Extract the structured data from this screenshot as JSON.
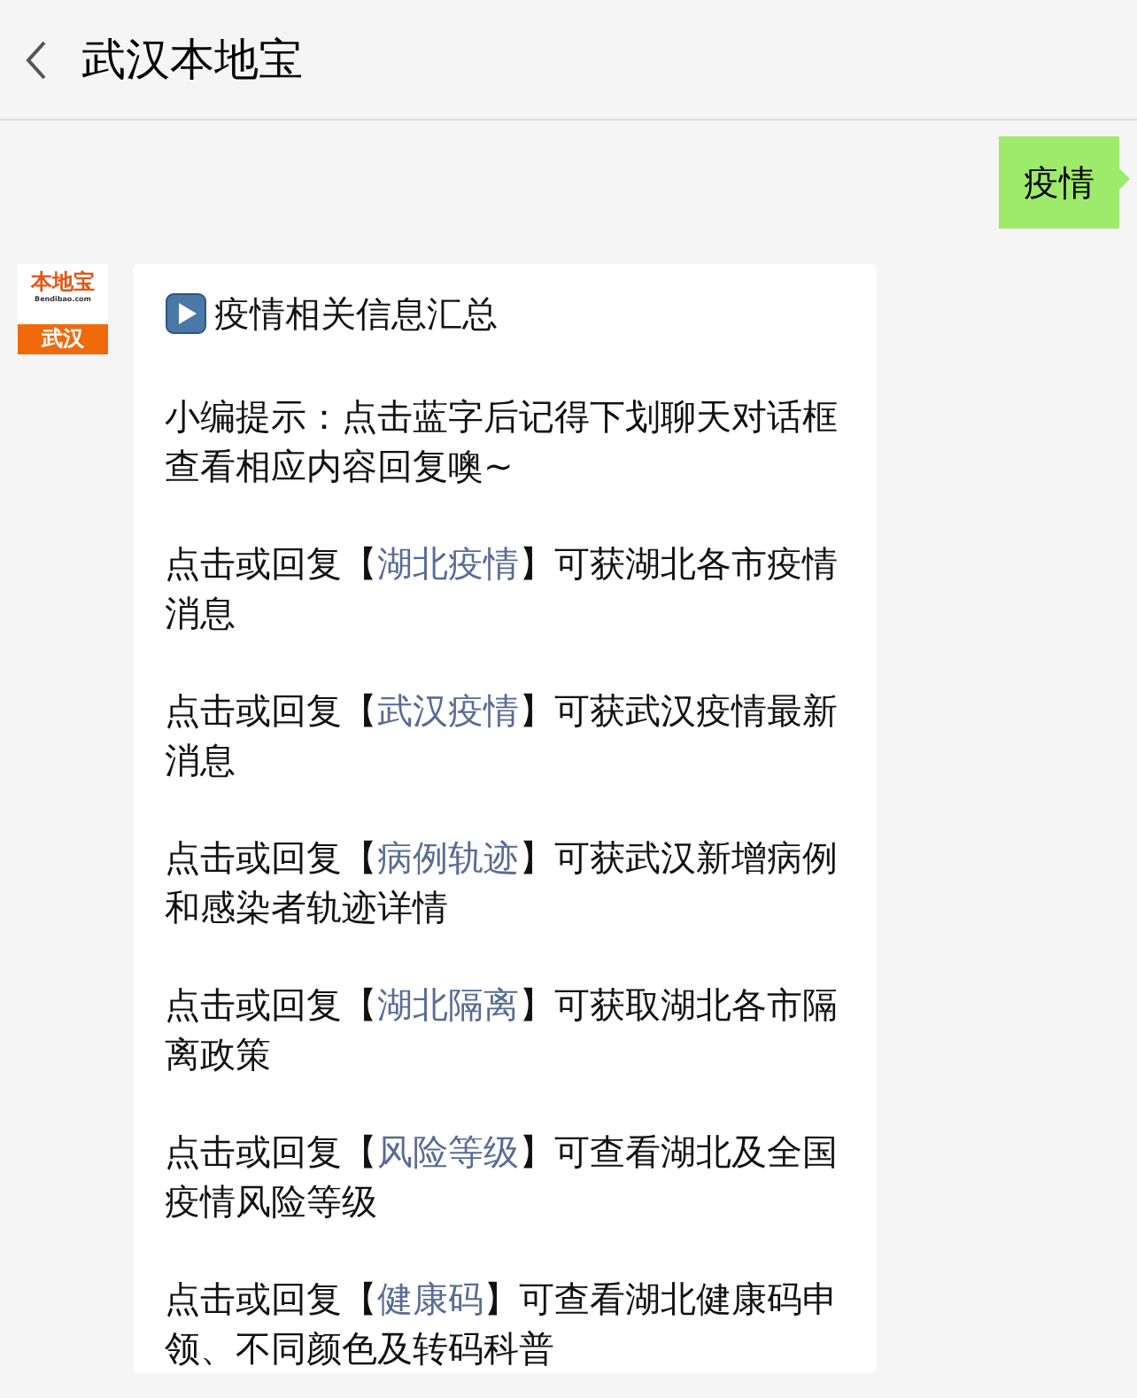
{
  "header": {
    "title": "武汉本地宝"
  },
  "messages": [
    {
      "kind": "outgoing",
      "text": "疫情"
    },
    {
      "kind": "incoming",
      "avatar": {
        "logo": "本地宝",
        "domain": "Bendibao.com",
        "city": "武汉"
      },
      "title": "疫情相关信息汇总",
      "paragraphs": [
        {
          "before": "小编提示：点击蓝字后记得下划聊天对话框查看相应内容回复噢~"
        },
        {
          "before": "点击或回复【",
          "link": "湖北疫情",
          "after": "】可获湖北各市疫情消息"
        },
        {
          "before": "点击或回复【",
          "link": "武汉疫情",
          "after": "】可获武汉疫情最新消息"
        },
        {
          "before": "点击或回复【",
          "link": "病例轨迹",
          "after": "】可获武汉新增病例和感染者轨迹详情"
        },
        {
          "before": "点击或回复【",
          "link": "湖北隔离",
          "after": "】可获取湖北各市隔离政策"
        },
        {
          "before": "点击或回复【",
          "link": "风险等级",
          "after": "】可查看湖北及全国疫情风险等级"
        },
        {
          "before": "点击或回复【",
          "link": "健康码",
          "after": "】可查看湖北健康码申领、不同颜色及转码科普"
        }
      ]
    }
  ]
}
